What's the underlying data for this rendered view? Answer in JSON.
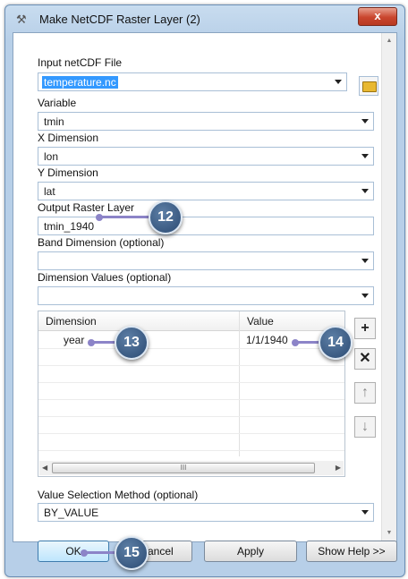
{
  "window": {
    "title": "Make NetCDF Raster Layer (2)",
    "close_label": "x"
  },
  "form": {
    "input_netcdf": {
      "label": "Input netCDF File",
      "value": "temperature.nc"
    },
    "variable": {
      "label": "Variable",
      "value": "tmin"
    },
    "x_dimension": {
      "label": "X Dimension",
      "value": "lon"
    },
    "y_dimension": {
      "label": "Y Dimension",
      "value": "lat"
    },
    "output_raster": {
      "label": "Output Raster Layer",
      "value": "tmin_1940"
    },
    "band_dimension": {
      "label": "Band Dimension (optional)",
      "value": ""
    },
    "dimension_values": {
      "label": "Dimension Values (optional)",
      "value": "",
      "columns": [
        "Dimension",
        "Value"
      ],
      "rows": [
        {
          "dimension": "year",
          "value": "1/1/1940"
        }
      ]
    },
    "value_selection": {
      "label": "Value Selection Method (optional)",
      "value": "BY_VALUE"
    }
  },
  "buttons": {
    "ok": "OK",
    "cancel": "Cancel",
    "apply": "Apply",
    "show_help": "Show Help >>"
  },
  "callouts": {
    "c12": "12",
    "c13": "13",
    "c14": "14",
    "c15": "15"
  },
  "icons": [
    "app-icon",
    "close-icon",
    "folder-icon",
    "dropdown-arrow-icon",
    "add-icon",
    "delete-icon",
    "up-arrow-icon",
    "down-arrow-icon"
  ]
}
